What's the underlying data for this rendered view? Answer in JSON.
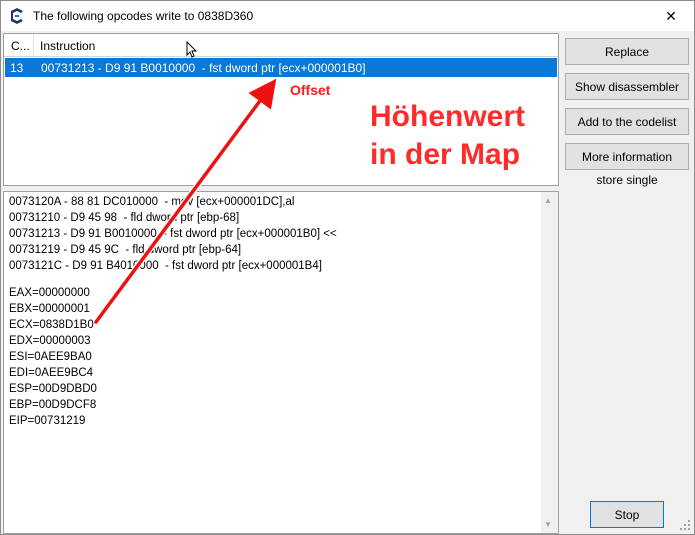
{
  "window": {
    "title": "The following opcodes write to 0838D360",
    "close_label": "✕"
  },
  "list": {
    "columns": [
      "C...",
      "Instruction"
    ],
    "rows": [
      {
        "count": "13",
        "instruction": "00731213 - D9 91 B0010000  - fst dword ptr [ecx+000001B0]"
      }
    ]
  },
  "code": {
    "lines": [
      "0073120A - 88 81 DC010000  - mov [ecx+000001DC],al",
      "00731210 - D9 45 98  - fld dword ptr [ebp-68]",
      "00731213 - D9 91 B0010000  - fst dword ptr [ecx+000001B0] <<",
      "00731219 - D9 45 9C  - fld dword ptr [ebp-64]",
      "0073121C - D9 91 B4010000  - fst dword ptr [ecx+000001B4]",
      "",
      "EAX=00000000",
      "EBX=00000001",
      "ECX=0838D1B0",
      "EDX=00000003",
      "ESI=0AEE9BA0",
      "EDI=0AEE9BC4",
      "ESP=00D9DBD0",
      "EBP=00D9DCF8",
      "EIP=00731219"
    ]
  },
  "buttons": {
    "replace": "Replace",
    "show_disassembler": "Show disassembler",
    "add_to_codelist": "Add to the codelist",
    "more_information": "More information",
    "stop": "Stop"
  },
  "status_text": "store single",
  "annotations": {
    "offset_label": "Offset",
    "big_line1": "Höhenwert",
    "big_line2": "in der Map",
    "color": "#ff1a1a"
  },
  "colors": {
    "selection": "#0a78d7",
    "accent_button_border": "#0078d7"
  },
  "icons": [
    "cheat-engine-icon",
    "close-icon",
    "mouse-cursor-icon",
    "scroll-up-icon",
    "scroll-down-icon",
    "resize-grip-icon"
  ]
}
